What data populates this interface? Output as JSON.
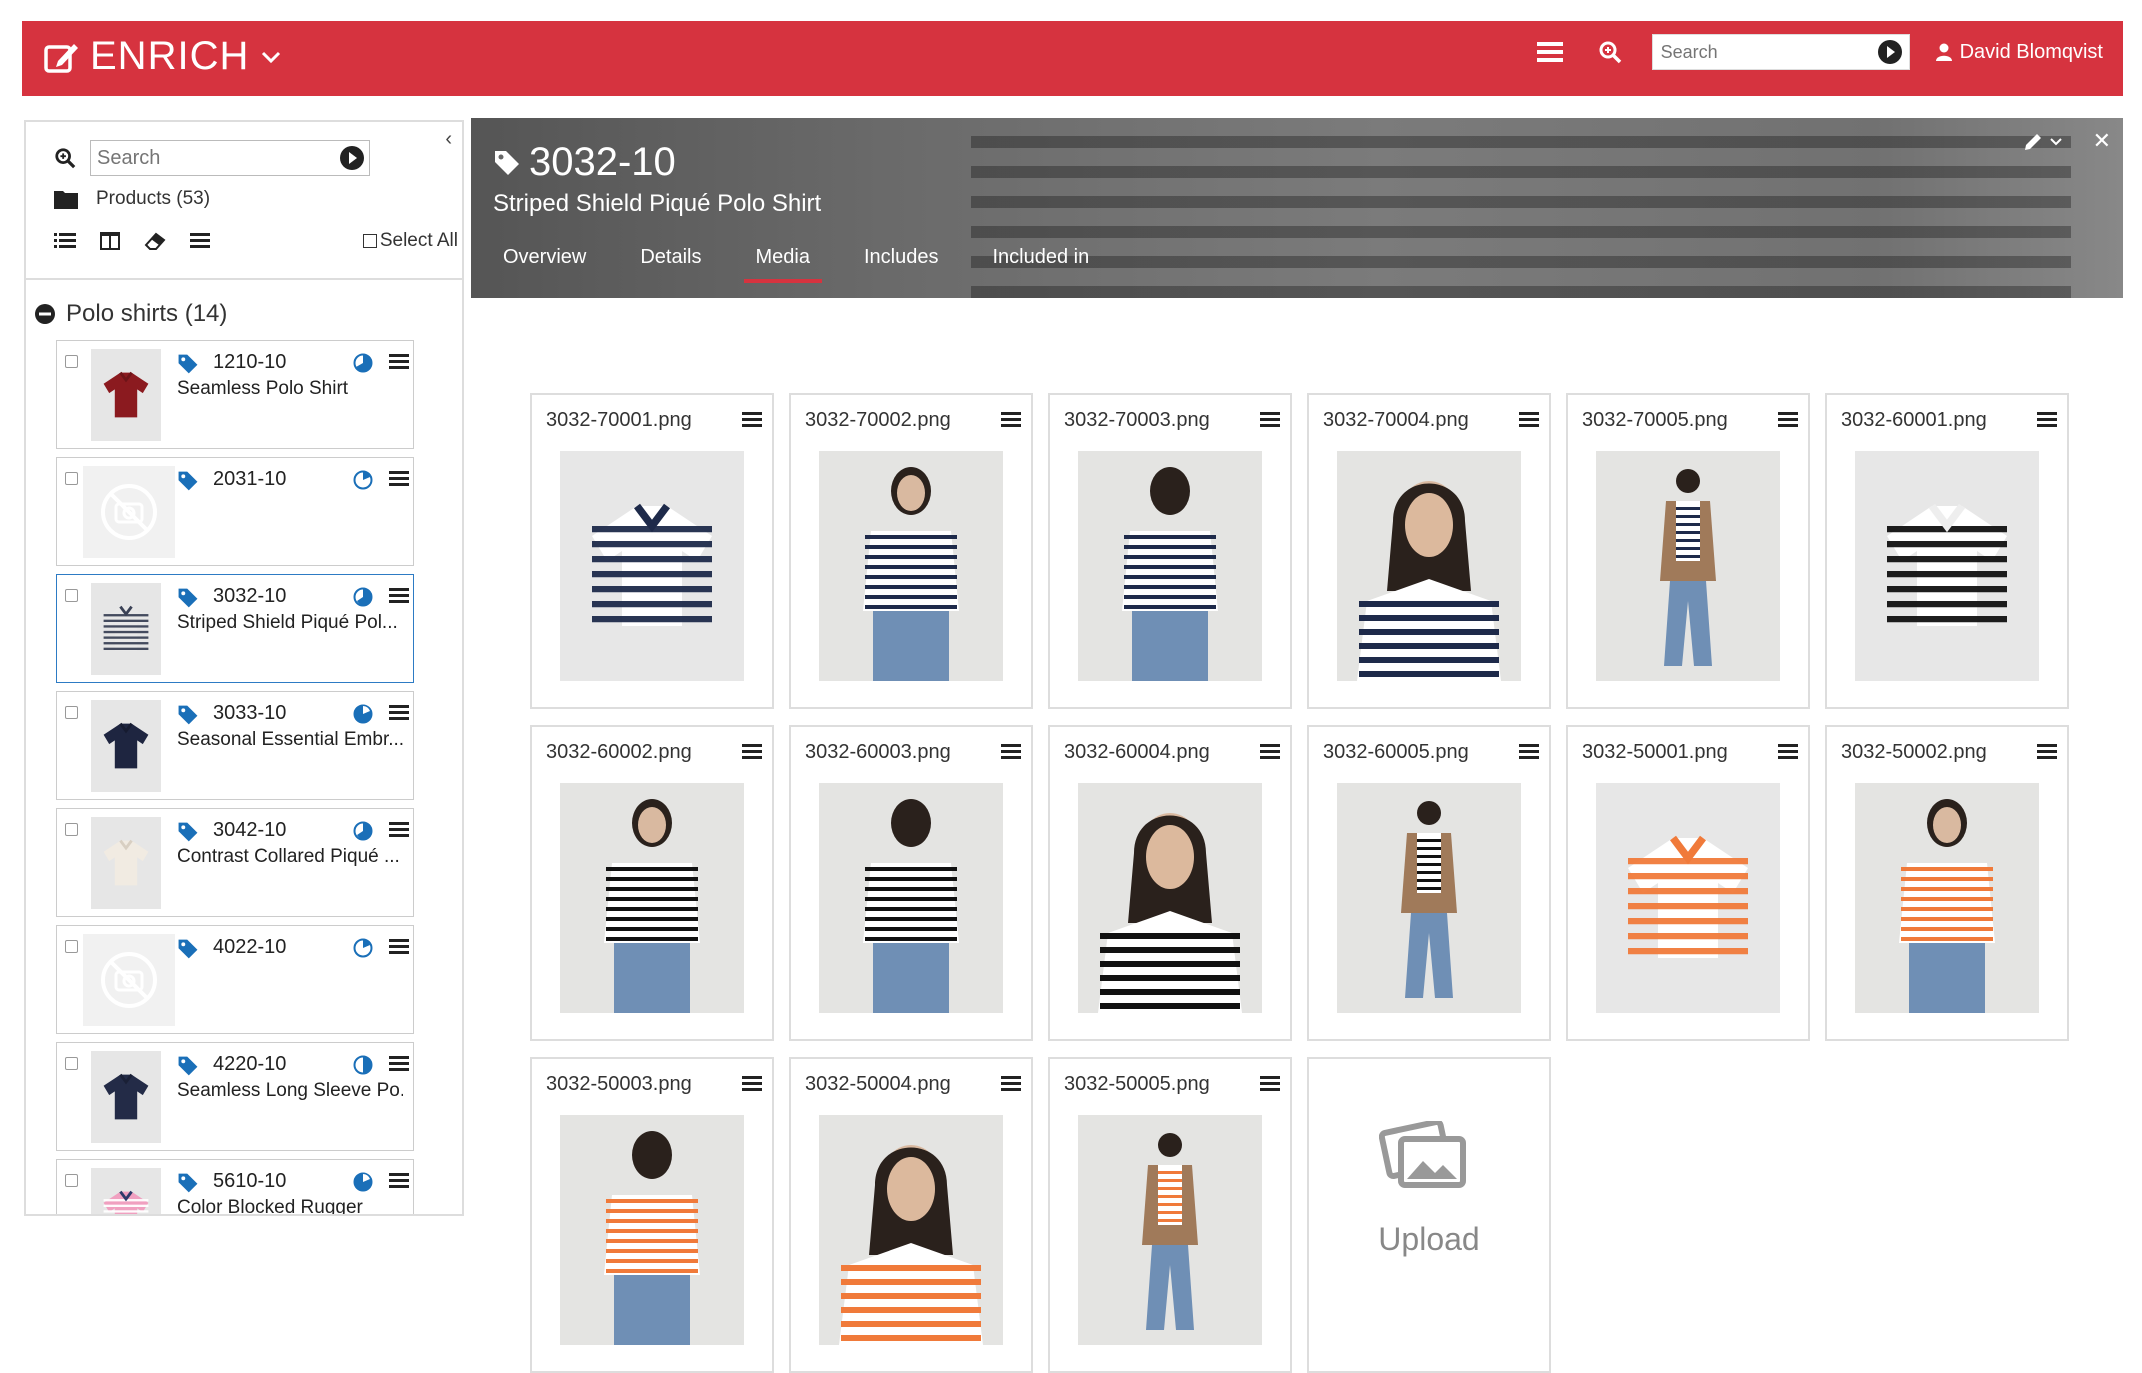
{
  "header": {
    "app_name": "ENRICH",
    "search_placeholder": "Search",
    "user_name": "David Blomqvist",
    "brand_color": "#d6333f"
  },
  "sidebar": {
    "search_placeholder": "Search",
    "products_label": "Products (53)",
    "select_all_label": "Select All",
    "group_label": "Polo shirts (14)",
    "items": [
      {
        "code": "1210-10",
        "name": "Seamless Polo Shirt",
        "thumb": "polo-red"
      },
      {
        "code": "2031-10",
        "name": "",
        "thumb": "no-image"
      },
      {
        "code": "3032-10",
        "name": "Striped Shield Piqué Pol...",
        "thumb": "polo-striped",
        "selected": true
      },
      {
        "code": "3033-10",
        "name": "Seasonal Essential Embr...",
        "thumb": "polo-navy"
      },
      {
        "code": "3042-10",
        "name": "Contrast Collared Piqué ...",
        "thumb": "polo-cream"
      },
      {
        "code": "4022-10",
        "name": "",
        "thumb": "no-image"
      },
      {
        "code": "4220-10",
        "name": "Seamless Long Sleeve Po...",
        "thumb": "polo-navy-long"
      },
      {
        "code": "5610-10",
        "name": "Color Blocked Rugger",
        "thumb": "rugger"
      }
    ]
  },
  "detail": {
    "code": "3032-10",
    "title": "Striped Shield Piqué Polo Shirt",
    "tabs": [
      "Overview",
      "Details",
      "Media",
      "Includes",
      "Included in"
    ],
    "active_tab": "Media"
  },
  "media": {
    "items": [
      {
        "file": "3032-70001.png",
        "kind": "product",
        "color": "navy"
      },
      {
        "file": "3032-70002.png",
        "kind": "model",
        "color": "navy"
      },
      {
        "file": "3032-70003.png",
        "kind": "model-back",
        "color": "navy"
      },
      {
        "file": "3032-70004.png",
        "kind": "model-close",
        "color": "navy"
      },
      {
        "file": "3032-70005.png",
        "kind": "model-full",
        "color": "navy"
      },
      {
        "file": "3032-60001.png",
        "kind": "product",
        "color": "black"
      },
      {
        "file": "3032-60002.png",
        "kind": "model",
        "color": "black"
      },
      {
        "file": "3032-60003.png",
        "kind": "model-back",
        "color": "black"
      },
      {
        "file": "3032-60004.png",
        "kind": "model-close",
        "color": "black"
      },
      {
        "file": "3032-60005.png",
        "kind": "model-full",
        "color": "black"
      },
      {
        "file": "3032-50001.png",
        "kind": "product",
        "color": "orange"
      },
      {
        "file": "3032-50002.png",
        "kind": "model",
        "color": "orange"
      },
      {
        "file": "3032-50003.png",
        "kind": "model-back",
        "color": "orange"
      },
      {
        "file": "3032-50004.png",
        "kind": "model-close",
        "color": "orange"
      },
      {
        "file": "3032-50005.png",
        "kind": "model-full",
        "color": "orange"
      }
    ],
    "upload_label": "Upload"
  }
}
